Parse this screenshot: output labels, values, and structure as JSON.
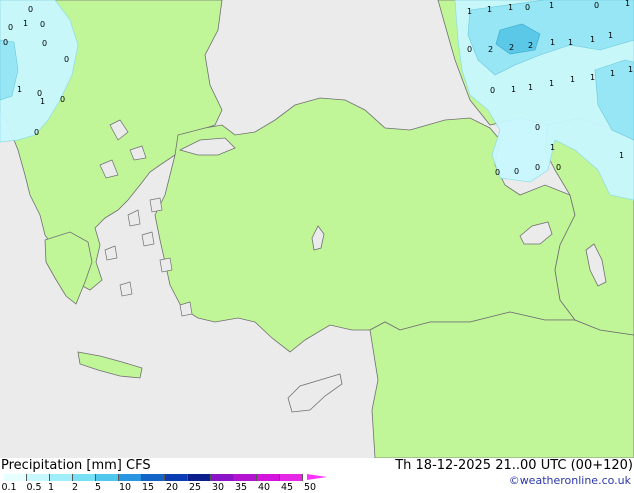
{
  "map": {
    "title": "Precipitation [mm] CFS",
    "timestamp": "Th 18-12-2025 21..00 UTC (00+120)",
    "copyright": "©weatheronline.co.uk",
    "colors": {
      "land": "#c0f598",
      "sea": "#ebebeb",
      "precip_light": "#c8f8ff",
      "precip_mid": "#96e6f5",
      "precip_strong": "#5ac8e6",
      "coast": "#707070"
    },
    "legend": {
      "ticks": [
        "0.1",
        "0.5",
        "1",
        "2",
        "5",
        "10",
        "15",
        "20",
        "25",
        "30",
        "35",
        "40",
        "45",
        "50"
      ],
      "swatch_colors": [
        "#e6ffff",
        "#c8f8ff",
        "#a0eefa",
        "#78e0f5",
        "#50c8ee",
        "#2896e0",
        "#1464c8",
        "#0a3cb4",
        "#0a1e8c",
        "#8c14c8",
        "#b414d2",
        "#d214dc",
        "#e628e6"
      ],
      "arrow_color": "#ff33ff"
    },
    "value_labels": [
      {
        "text": "0"
      },
      {
        "text": "0"
      },
      {
        "text": "0"
      },
      {
        "text": "0"
      },
      {
        "text": "1"
      },
      {
        "text": "0"
      },
      {
        "text": "1"
      },
      {
        "text": "0"
      },
      {
        "text": "0"
      },
      {
        "text": "0"
      },
      {
        "text": "0"
      },
      {
        "text": "1"
      },
      {
        "text": "1"
      },
      {
        "text": "1"
      },
      {
        "text": "0"
      },
      {
        "text": "1"
      },
      {
        "text": "1"
      },
      {
        "text": "0"
      },
      {
        "text": "1"
      },
      {
        "text": "2"
      },
      {
        "text": "2"
      },
      {
        "text": "2"
      },
      {
        "text": "1"
      },
      {
        "text": "1"
      },
      {
        "text": "1"
      },
      {
        "text": "1"
      },
      {
        "text": "0"
      },
      {
        "text": "1"
      },
      {
        "text": "1"
      },
      {
        "text": "1"
      },
      {
        "text": "1"
      },
      {
        "text": "1"
      },
      {
        "text": "1"
      },
      {
        "text": "1"
      },
      {
        "text": "0"
      },
      {
        "text": "0"
      },
      {
        "text": "0"
      },
      {
        "text": "0"
      },
      {
        "text": "0"
      },
      {
        "text": "0"
      },
      {
        "text": "1"
      },
      {
        "text": "1"
      }
    ]
  }
}
